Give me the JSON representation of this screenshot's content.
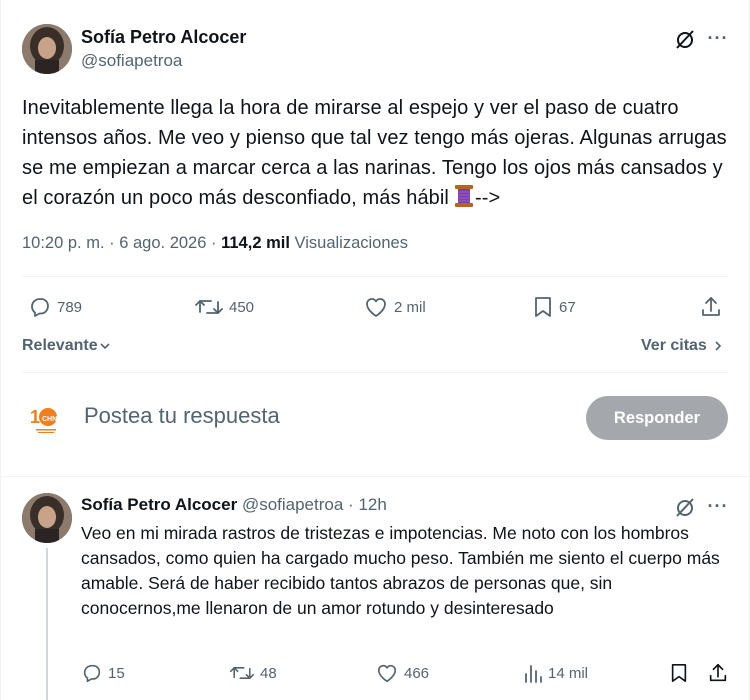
{
  "main_tweet": {
    "author_name": "Sofía Petro Alcocer",
    "author_handle": "@sofiapetroa",
    "text": "Inevitablemente llega la hora  de mirarse al espejo y ver el paso de cuatro intensos años. Me veo y pienso que tal vez tengo más ojeras. Algunas arrugas se me empiezan a marcar cerca a las narinas. Tengo los ojos más cansados y el corazón un poco más desconfiado, más hábil",
    "text_suffix": "-->",
    "time": "10:20 p. m.",
    "date": "6 ago. 2026",
    "views": "114,2 mil",
    "views_label": "Visualizaciones",
    "stats": {
      "replies": "789",
      "reposts": "450",
      "likes": "2 mil",
      "bookmarks": "67"
    }
  },
  "sort": {
    "label": "Relevante",
    "quotes_label": "Ver citas"
  },
  "composer": {
    "placeholder": "Postea tu respuesta",
    "button_label": "Responder"
  },
  "thread_tweet": {
    "author_name": "Sofía Petro Alcocer",
    "author_handle": "@sofiapetroa",
    "separator": "·",
    "age": "12h",
    "text": "Veo en mi mirada rastros de tristezas e impotencias. Me noto con los hombros cansados, como quien ha cargado mucho peso. También me siento el cuerpo más amable.  Será de haber recibido tantos abrazos de personas que, sin conocernos,me llenaron de un amor rotundo y desinteresado",
    "stats": {
      "replies": "15",
      "reposts": "48",
      "likes": "466",
      "views": "14 mil"
    }
  },
  "colors": {
    "text_primary": "#0f1419",
    "text_secondary": "#536471",
    "button_disabled": "#a4a7ab",
    "brand_orange": "#f07f1e"
  },
  "icons": [
    "grok-icon",
    "more-icon",
    "reply-icon",
    "repost-icon",
    "like-icon",
    "bookmark-icon",
    "share-icon",
    "views-icon",
    "chevron-down-icon",
    "chevron-right-icon",
    "spool-emoji"
  ]
}
